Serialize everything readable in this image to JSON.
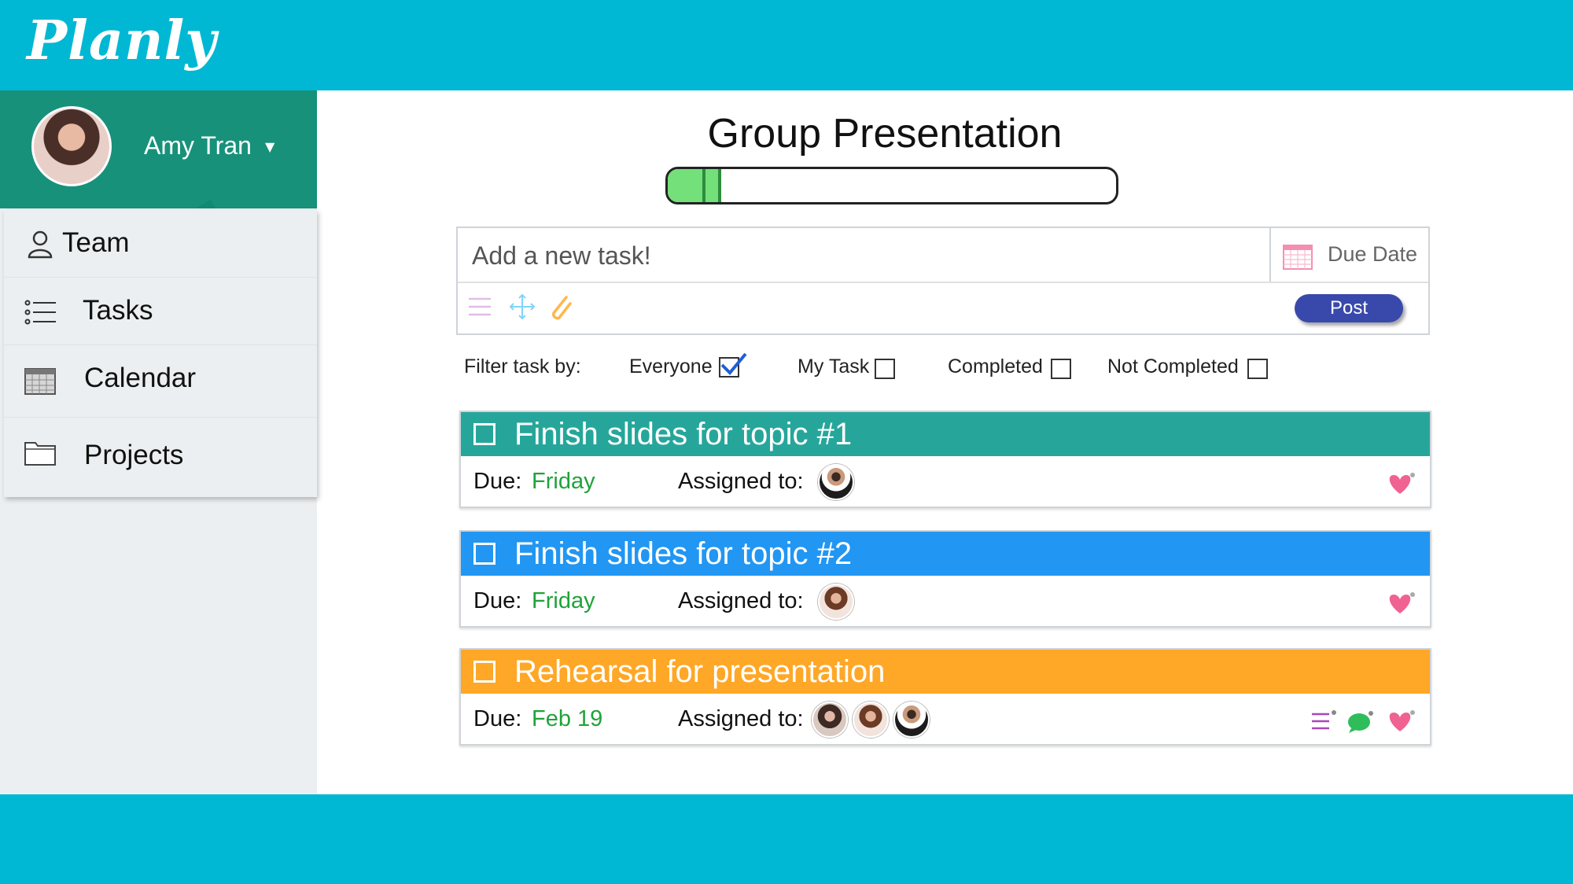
{
  "app": {
    "name": "Planly"
  },
  "user": {
    "name": "Amy Tran"
  },
  "nav": {
    "items": [
      {
        "label": "Team",
        "icon": "person-icon"
      },
      {
        "label": "Tasks",
        "icon": "list-icon"
      },
      {
        "label": "Calendar",
        "icon": "calendar-icon"
      },
      {
        "label": "Projects",
        "icon": "folder-icon"
      }
    ]
  },
  "project": {
    "title": "Group Presentation",
    "progress": 0.12
  },
  "composer": {
    "placeholder": "Add a new task!",
    "due_date_label": "Due Date",
    "post_label": "Post"
  },
  "filter": {
    "label": "Filter task by:",
    "options": [
      {
        "label": "Everyone",
        "checked": true
      },
      {
        "label": "My Task",
        "checked": false
      },
      {
        "label": "Completed",
        "checked": false
      },
      {
        "label": "Not Completed",
        "checked": false
      }
    ]
  },
  "tasks": [
    {
      "title": "Finish slides for topic #1",
      "due_label": "Due:",
      "due": "Friday",
      "assigned_label": "Assigned to:",
      "color": "#26a69a"
    },
    {
      "title": "Finish slides for topic #2",
      "due_label": "Due:",
      "due": "Friday",
      "assigned_label": "Assigned to:",
      "color": "#2196f3"
    },
    {
      "title": "Rehearsal for presentation",
      "due_label": "Due:",
      "due": "Feb 19",
      "assigned_label": "Assigned to:",
      "color": "#ffa726"
    }
  ],
  "colors": {
    "header": "#00b8d4",
    "sidebar_profile": "#17917a",
    "post_button": "#3949ab",
    "due_text": "#1fa33a"
  }
}
